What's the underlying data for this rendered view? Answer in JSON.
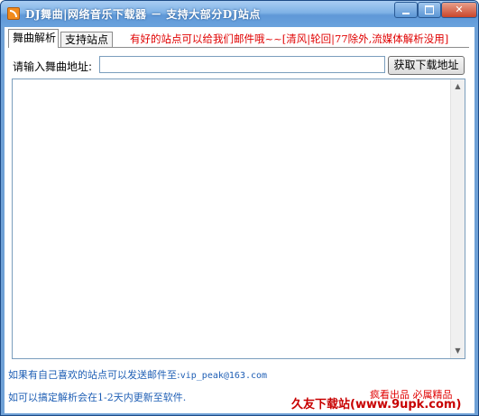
{
  "window": {
    "title": "DJ舞曲|网络音乐下载器 － 支持大部分DJ站点",
    "icon": "rss-app-icon"
  },
  "tabs": [
    {
      "label": "舞曲解析",
      "active": true
    },
    {
      "label": "支持站点",
      "active": false
    }
  ],
  "notice": "有好的站点可以给我们邮件哦~~[清风|轮回|77除外,流媒体解析没用]",
  "form": {
    "url_label": "请输入舞曲地址:",
    "url_value": "",
    "fetch_button": "获取下载地址"
  },
  "footer": {
    "line1_text": "如果有自己喜欢的站点可以发送邮件至:",
    "email": "vip_peak@163.com",
    "line2_text": "如可以搞定解析会在1-2天内更新至软件.",
    "brand": "疯看出品 必属精品"
  },
  "watermark": "久友下载站(www.9upk.com)",
  "colors": {
    "notice": "#e00000",
    "footer_text": "#1f5fb5",
    "titlebar": "#6fa1d6"
  }
}
